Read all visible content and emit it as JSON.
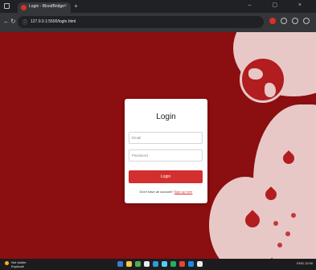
{
  "browser": {
    "tab_title": "Login - BloodBridge",
    "tab_close": "×",
    "new_tab": "+",
    "window_controls": "– ▢ ×",
    "url": "127.0.0.1:5500/login.html",
    "nav_back": "←",
    "nav_reload": "↻"
  },
  "login": {
    "title": "Login",
    "email_placeholder": "Email",
    "password_placeholder": "Password",
    "button_label": "Login",
    "signup_prompt": "Don't have an account?",
    "signup_link": "Sign up here"
  },
  "taskbar": {
    "weather_line1": "Not visible",
    "weather_line2": "ExpAvail",
    "tray_text": "ENG  12:00"
  },
  "colors": {
    "background": "#8b0e10",
    "accent": "#d32f2f",
    "card": "#ffffff"
  }
}
